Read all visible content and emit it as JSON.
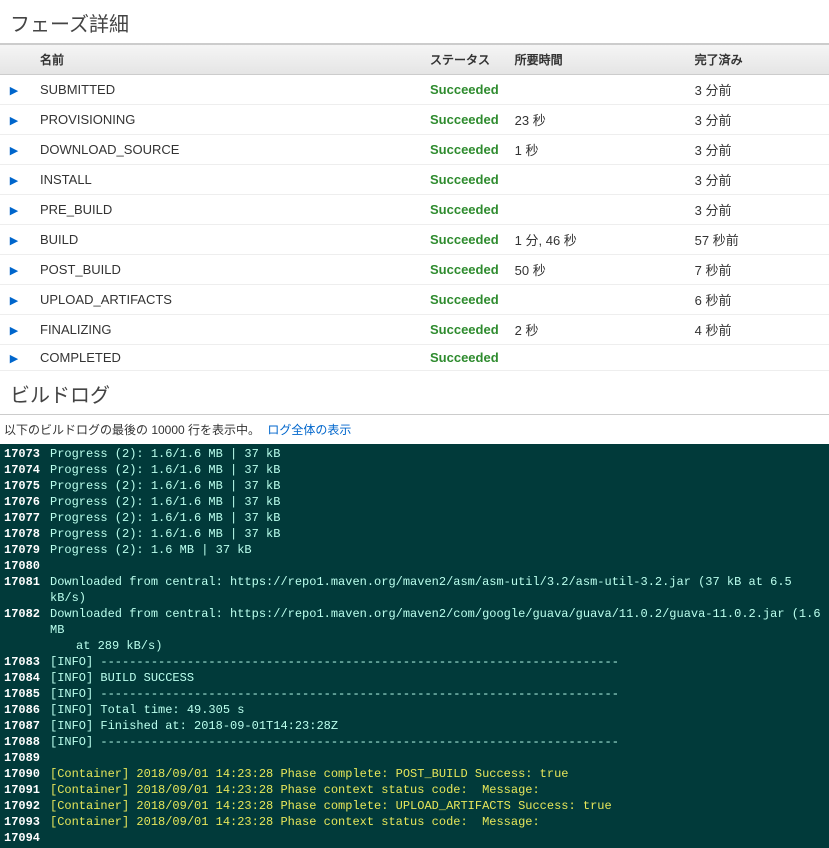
{
  "phase": {
    "title": "フェーズ詳細",
    "columns": {
      "name": "名前",
      "status": "ステータス",
      "duration": "所要時間",
      "completed": "完了済み"
    },
    "rows": [
      {
        "name": "SUBMITTED",
        "status": "Succeeded",
        "duration": "",
        "completed": "3 分前"
      },
      {
        "name": "PROVISIONING",
        "status": "Succeeded",
        "duration": "23 秒",
        "completed": "3 分前"
      },
      {
        "name": "DOWNLOAD_SOURCE",
        "status": "Succeeded",
        "duration": "1 秒",
        "completed": "3 分前"
      },
      {
        "name": "INSTALL",
        "status": "Succeeded",
        "duration": "",
        "completed": "3 分前"
      },
      {
        "name": "PRE_BUILD",
        "status": "Succeeded",
        "duration": "",
        "completed": "3 分前"
      },
      {
        "name": "BUILD",
        "status": "Succeeded",
        "duration": "1 分, 46 秒",
        "completed": "57 秒前"
      },
      {
        "name": "POST_BUILD",
        "status": "Succeeded",
        "duration": "50 秒",
        "completed": "7 秒前"
      },
      {
        "name": "UPLOAD_ARTIFACTS",
        "status": "Succeeded",
        "duration": "",
        "completed": "6 秒前"
      },
      {
        "name": "FINALIZING",
        "status": "Succeeded",
        "duration": "2 秒",
        "completed": "4 秒前"
      },
      {
        "name": "COMPLETED",
        "status": "Succeeded",
        "duration": "",
        "completed": ""
      }
    ]
  },
  "log": {
    "title": "ビルドログ",
    "summary_prefix": "以下のビルドログの最後の 10000 行を表示中。",
    "view_all_link": "ログ全体の表示",
    "lines": [
      {
        "n": "17073",
        "t": "Progress (2): 1.6/1.6 MB | 37 kB"
      },
      {
        "n": "17074",
        "t": "Progress (2): 1.6/1.6 MB | 37 kB"
      },
      {
        "n": "17075",
        "t": "Progress (2): 1.6/1.6 MB | 37 kB"
      },
      {
        "n": "17076",
        "t": "Progress (2): 1.6/1.6 MB | 37 kB"
      },
      {
        "n": "17077",
        "t": "Progress (2): 1.6/1.6 MB | 37 kB"
      },
      {
        "n": "17078",
        "t": "Progress (2): 1.6/1.6 MB | 37 kB"
      },
      {
        "n": "17079",
        "t": "Progress (2): 1.6 MB | 37 kB"
      },
      {
        "n": "17080",
        "t": ""
      },
      {
        "n": "17081",
        "t": "Downloaded from central: https://repo1.maven.org/maven2/asm/asm-util/3.2/asm-util-3.2.jar (37 kB at 6.5 kB/s)"
      },
      {
        "n": "17082",
        "t": "Downloaded from central: https://repo1.maven.org/maven2/com/google/guava/guava/11.0.2/guava-11.0.2.jar (1.6 MB at 289 kB/s)",
        "wrap": true
      },
      {
        "n": "17083",
        "t": "[INFO] ------------------------------------------------------------------------"
      },
      {
        "n": "17084",
        "t": "[INFO] BUILD SUCCESS"
      },
      {
        "n": "17085",
        "t": "[INFO] ------------------------------------------------------------------------"
      },
      {
        "n": "17086",
        "t": "[INFO] Total time: 49.305 s"
      },
      {
        "n": "17087",
        "t": "[INFO] Finished at: 2018-09-01T14:23:28Z"
      },
      {
        "n": "17088",
        "t": "[INFO] ------------------------------------------------------------------------"
      },
      {
        "n": "17089",
        "t": ""
      },
      {
        "n": "17090",
        "t": "[Container] 2018/09/01 14:23:28 Phase complete: POST_BUILD Success: true",
        "cls": "log-yellow"
      },
      {
        "n": "17091",
        "t": "[Container] 2018/09/01 14:23:28 Phase context status code:  Message:",
        "cls": "log-yellow"
      },
      {
        "n": "17092",
        "t": "[Container] 2018/09/01 14:23:28 Phase complete: UPLOAD_ARTIFACTS Success: true",
        "cls": "log-yellow"
      },
      {
        "n": "17093",
        "t": "[Container] 2018/09/01 14:23:28 Phase context status code:  Message:",
        "cls": "log-yellow"
      },
      {
        "n": "17094",
        "t": ""
      }
    ]
  }
}
